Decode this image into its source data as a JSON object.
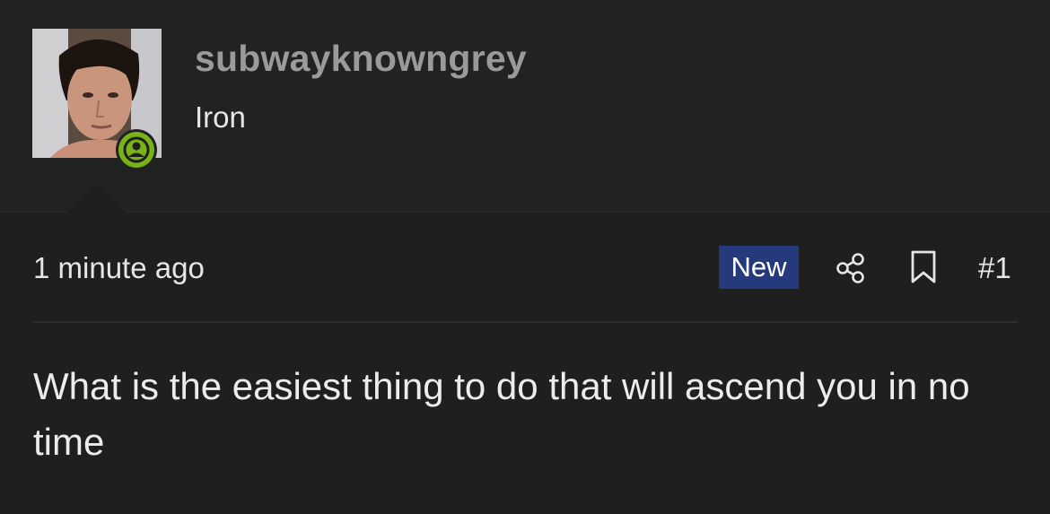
{
  "author": {
    "username": "subwayknowngrey",
    "title": "Iron",
    "avatar_icon": "user-avatar-photo",
    "status_icon": "user-online-icon",
    "status_color": "#7ab317"
  },
  "post": {
    "timestamp": "1 minute ago",
    "badge": "New",
    "badge_color": "#25397d",
    "share_icon": "share-icon",
    "bookmark_icon": "bookmark-icon",
    "number": "#1",
    "body": "What is the easiest thing to do that will ascend you in no time"
  }
}
